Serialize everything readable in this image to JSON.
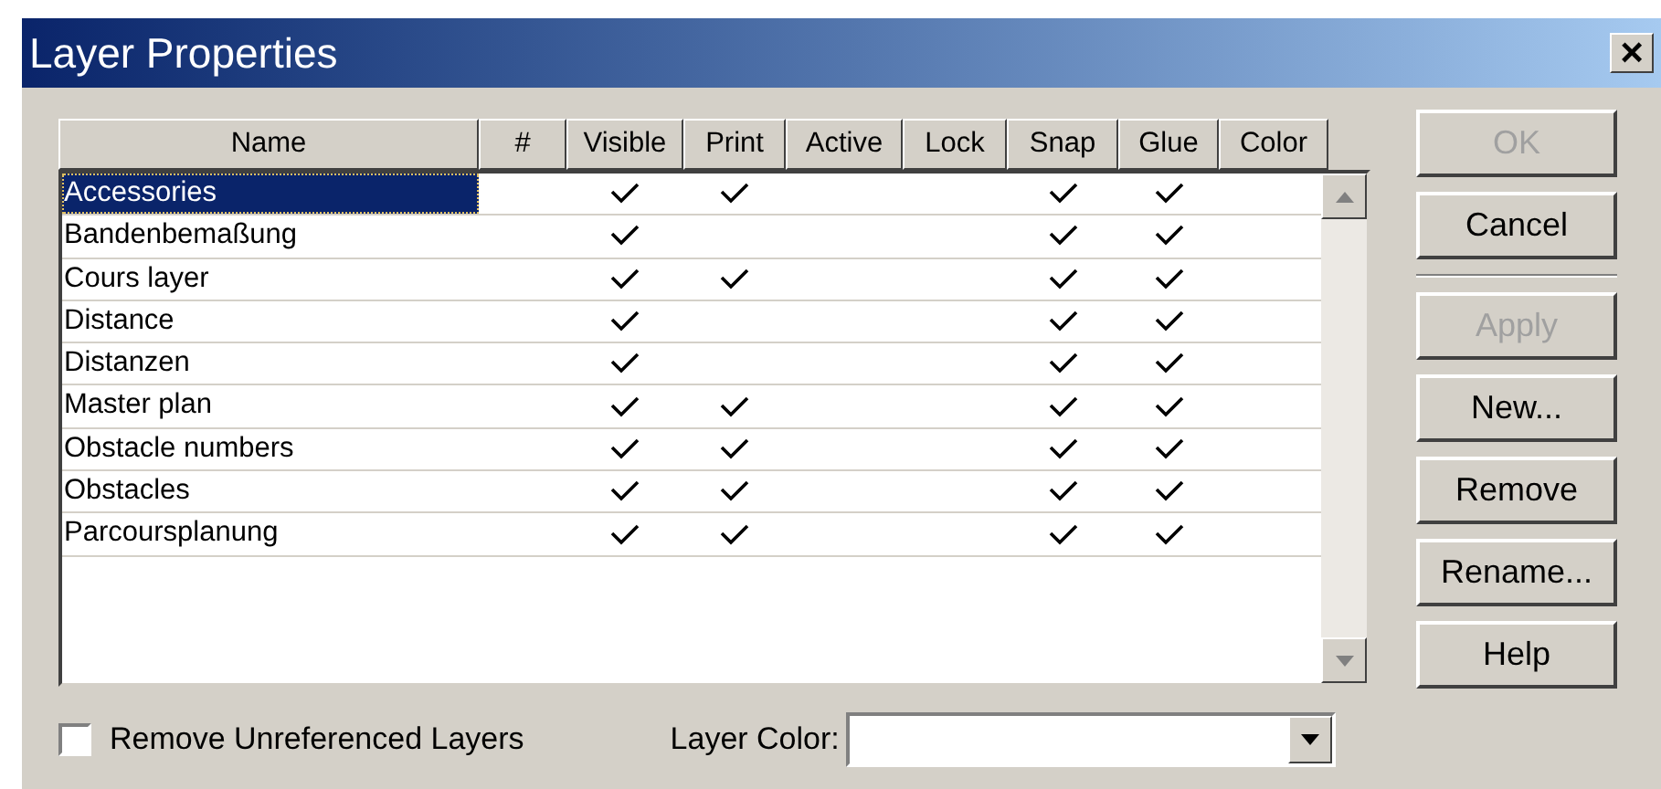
{
  "window": {
    "title": "Layer Properties",
    "close": "×"
  },
  "table": {
    "columns": [
      "Name",
      "#",
      "Visible",
      "Print",
      "Active",
      "Lock",
      "Snap",
      "Glue",
      "Color"
    ],
    "rows": [
      {
        "name": "Accessories",
        "selected": true,
        "visible": true,
        "print": true,
        "active": false,
        "lock": false,
        "snap": true,
        "glue": true
      },
      {
        "name": "Bandenbemaßung",
        "selected": false,
        "visible": true,
        "print": false,
        "active": false,
        "lock": false,
        "snap": true,
        "glue": true
      },
      {
        "name": "Cours layer",
        "selected": false,
        "visible": true,
        "print": true,
        "active": false,
        "lock": false,
        "snap": true,
        "glue": true
      },
      {
        "name": "Distance",
        "selected": false,
        "visible": true,
        "print": false,
        "active": false,
        "lock": false,
        "snap": true,
        "glue": true
      },
      {
        "name": "Distanzen",
        "selected": false,
        "visible": true,
        "print": false,
        "active": false,
        "lock": false,
        "snap": true,
        "glue": true
      },
      {
        "name": "Master plan",
        "selected": false,
        "visible": true,
        "print": true,
        "active": false,
        "lock": false,
        "snap": true,
        "glue": true
      },
      {
        "name": "Obstacle numbers",
        "selected": false,
        "visible": true,
        "print": true,
        "active": false,
        "lock": false,
        "snap": true,
        "glue": true
      },
      {
        "name": "Obstacles",
        "selected": false,
        "visible": true,
        "print": true,
        "active": false,
        "lock": false,
        "snap": true,
        "glue": true
      },
      {
        "name": "Parcoursplanung",
        "selected": false,
        "visible": true,
        "print": true,
        "active": false,
        "lock": false,
        "snap": true,
        "glue": true
      }
    ]
  },
  "buttons": [
    {
      "label": "OK",
      "disabled": true
    },
    {
      "label": "Cancel",
      "disabled": false
    },
    {
      "label": "Apply",
      "disabled": true
    },
    {
      "label": "New...",
      "disabled": false
    },
    {
      "label": "Remove",
      "disabled": false
    },
    {
      "label": "Rename...",
      "disabled": false
    },
    {
      "label": "Help",
      "disabled": false
    }
  ],
  "remove_unreferenced": {
    "label": "Remove Unreferenced Layers",
    "checked": false
  },
  "layer_color": {
    "label": "Layer Color:"
  }
}
